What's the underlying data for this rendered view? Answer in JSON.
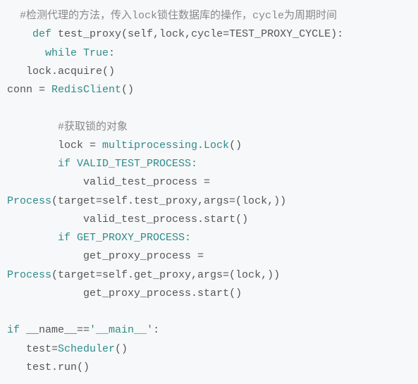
{
  "code": {
    "c1": "#检测代理的方法，传入lock锁住数据库的操作，cycle为周期时间",
    "l2_def": "def",
    "l2_fn": " test_proxy(self,lock,cycle=TEST_PROXY_CYCLE):",
    "l3_while": "while",
    "l3_true": " True",
    "l3_colon": ":",
    "l4": "   lock.acquire()",
    "l5_a": "conn = ",
    "l5_b": "RedisClient",
    "l5_c": "()",
    "c2": "#获取锁的对象",
    "l7_a": "        lock = ",
    "l7_b": "multiprocessing.Lock",
    "l7_c": "()",
    "l8_if": "if",
    "l8_b": " VALID_TEST_PROCESS:",
    "l9": "            valid_test_process = ",
    "l10_a": "Process",
    "l10_b": "(target=self.test_proxy,args=(lock,))",
    "l11": "            valid_test_process.start()",
    "l12_if": "if",
    "l12_b": " GET_PROXY_PROCESS:",
    "l13": "            get_proxy_process = ",
    "l14_a": "Process",
    "l14_b": "(target=self.get_proxy,args=(lock,))",
    "l15": "            get_proxy_process.start()",
    "l16_if": "if",
    "l16_a": " __name__==",
    "l16_b": "'__main__'",
    "l16_c": ":",
    "l17_a": "   test=",
    "l17_b": "Scheduler",
    "l17_c": "()",
    "l18": "   test.run()"
  }
}
